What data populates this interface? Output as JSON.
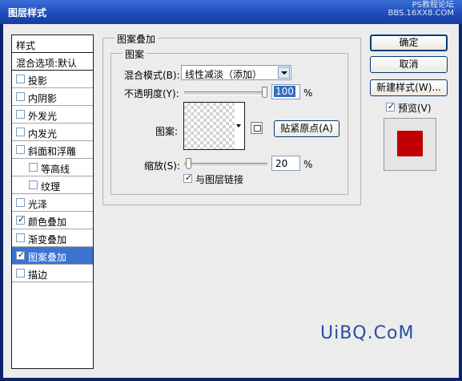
{
  "window": {
    "title": "图层样式"
  },
  "watermark_top": {
    "line1": "PS教程论坛",
    "line2": "BBS.16XX8.COM"
  },
  "watermark_bottom": "UiBQ.CoM",
  "left_panel": {
    "header": "样式",
    "blend_options": "混合选项:默认",
    "items": [
      {
        "label": "投影",
        "checked": false
      },
      {
        "label": "内阴影",
        "checked": false
      },
      {
        "label": "外发光",
        "checked": false
      },
      {
        "label": "内发光",
        "checked": false
      },
      {
        "label": "斜面和浮雕",
        "checked": false
      },
      {
        "label": "等高线",
        "checked": false
      },
      {
        "label": "纹理",
        "checked": false
      },
      {
        "label": "光泽",
        "checked": false
      },
      {
        "label": "颜色叠加",
        "checked": true
      },
      {
        "label": "渐变叠加",
        "checked": false
      },
      {
        "label": "图案叠加",
        "checked": true,
        "selected": true
      },
      {
        "label": "描边",
        "checked": false
      }
    ]
  },
  "pattern_overlay": {
    "group_title": "图案叠加",
    "subgroup_title": "图案",
    "blend_mode_label": "混合模式(B):",
    "blend_mode_value": "线性减淡（添加）",
    "opacity_label": "不透明度(Y):",
    "opacity_value": "100",
    "opacity_unit": "%",
    "opacity_level": 1.0,
    "pattern_label": "图案:",
    "snap_button": "贴紧原点(A)",
    "scale_label": "缩放(S):",
    "scale_value": "20",
    "scale_unit": "%",
    "scale_level": 0.02,
    "link_label": "与图层链接",
    "link_checked": true
  },
  "right_panel": {
    "ok": "确定",
    "cancel": "取消",
    "new_style": "新建样式(W)...",
    "preview_label": "预览(V)",
    "preview_checked": true
  },
  "colors": {
    "title_bar": "#1c4bb8",
    "selected_row": "#3b73d1",
    "preview_fill": "#c00000"
  }
}
